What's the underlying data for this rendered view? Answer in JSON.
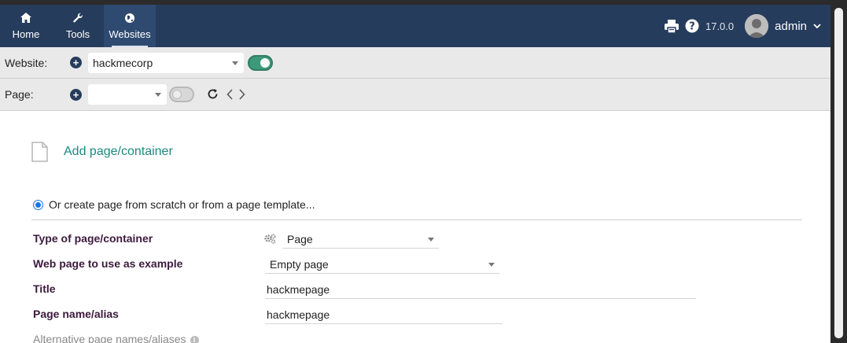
{
  "nav": {
    "items": [
      {
        "label": "Home",
        "icon": "home-icon"
      },
      {
        "label": "Tools",
        "icon": "wrench-icon"
      },
      {
        "label": "Websites",
        "icon": "globe-icon"
      }
    ],
    "version": "17.0.0",
    "username": "admin"
  },
  "website_row": {
    "label": "Website:",
    "selected": "hackmecorp",
    "toggle_state": "on"
  },
  "page_row": {
    "label": "Page:",
    "selected": "",
    "toggle_state": "off"
  },
  "main": {
    "add_page_link": "Add page/container",
    "radio_label": "Or create page from scratch or from a page template...",
    "form": {
      "type_label": "Type of page/container",
      "type_value": "Page",
      "example_label": "Web page to use as example",
      "example_value": "Empty page",
      "title_label": "Title",
      "title_value": "hackmepage",
      "alias_label": "Page name/alias",
      "alias_value": "hackmepage",
      "alt_alias_label": "Alternative page names/aliases"
    }
  },
  "colors": {
    "navbar": "#263c5c",
    "toggle_on": "#3c9a7a",
    "link": "#1b8a7f",
    "label": "#3d1a3d"
  }
}
